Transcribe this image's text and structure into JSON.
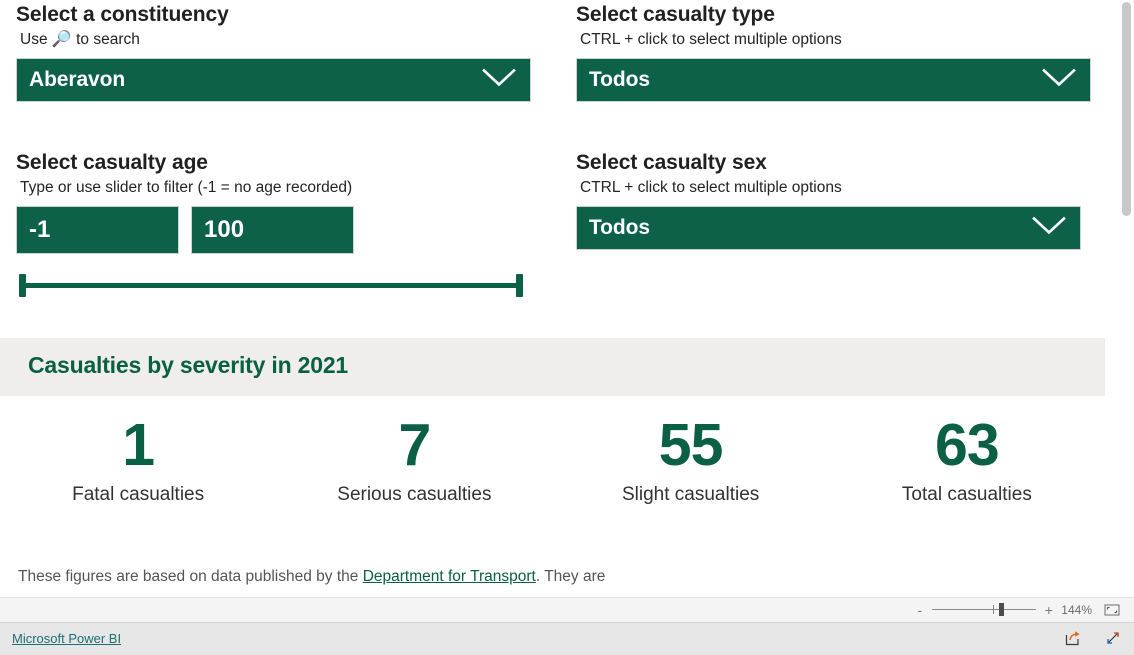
{
  "filters": {
    "constituency": {
      "title": "Select a constituency",
      "hint_before": "Use ",
      "hint_icon": "🔎",
      "hint_after": " to search",
      "value": "Aberavon",
      "icon": "chevron-down-icon"
    },
    "casualty_type": {
      "title": "Select casualty type",
      "hint": "CTRL + click to select multiple options",
      "value": "Todos",
      "icon": "chevron-down-icon"
    },
    "casualty_age": {
      "title": "Select casualty age",
      "hint": "Type or use slider to filter (-1 = no age recorded)",
      "min_value": "-1",
      "max_value": "100",
      "slider_min_pos": 0,
      "slider_max_pos": 100
    },
    "casualty_sex": {
      "title": "Select casualty sex",
      "hint": "CTRL + click to select multiple options",
      "value": "Todos",
      "icon": "chevron-down-icon"
    }
  },
  "section": {
    "title": "Casualties by severity in 2021"
  },
  "kpis": [
    {
      "value": "1",
      "label": "Fatal casualties"
    },
    {
      "value": "7",
      "label": "Serious casualties"
    },
    {
      "value": "55",
      "label": "Slight casualties"
    },
    {
      "value": "63",
      "label": "Total casualties"
    }
  ],
  "footnote": {
    "before": "These figures are based on data published by the ",
    "link": "Department for Transport",
    "after": ". They are"
  },
  "toolbar": {
    "zoom_out_label": "-",
    "zoom_in_label": "+",
    "zoom_percent": "144%",
    "fit_icon": "fit-to-page-icon"
  },
  "footer": {
    "brand": "Microsoft Power BI",
    "share_icon": "share-icon",
    "fullscreen_icon": "fullscreen-icon"
  },
  "colors": {
    "green_fill": "#0d6149",
    "green_text": "#0a6044",
    "band_grey": "#efeeed",
    "footer_grey": "#e7e6e6",
    "link_teal": "#1d6f73"
  }
}
